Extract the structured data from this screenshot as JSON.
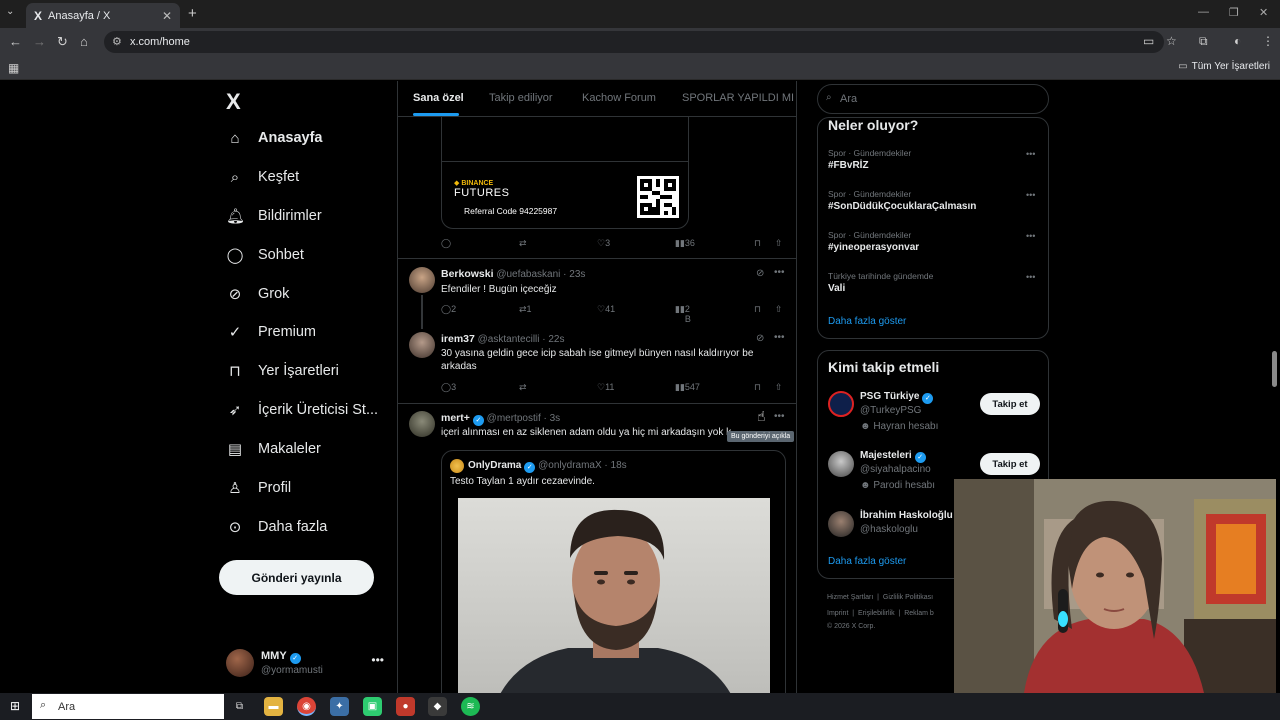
{
  "browser": {
    "tab_title": "Anasayfa / X",
    "tab_favicon": "X",
    "url": "x.com/home",
    "all_bookmarks": "Tüm Yer İşaretleri"
  },
  "sidebar": {
    "logo": "X",
    "items": [
      {
        "label": "Anasayfa",
        "icon": "home-icon"
      },
      {
        "label": "Keşfet",
        "icon": "search-icon"
      },
      {
        "label": "Bildirimler",
        "icon": "bell-icon"
      },
      {
        "label": "Sohbet",
        "icon": "chat-icon"
      },
      {
        "label": "Grok",
        "icon": "grok-icon"
      },
      {
        "label": "Premium",
        "icon": "premium-icon"
      },
      {
        "label": "Yer İşaretleri",
        "icon": "bookmark-icon"
      },
      {
        "label": "İçerik Üreticisi St...",
        "icon": "rocket-icon"
      },
      {
        "label": "Makaleler",
        "icon": "articles-icon"
      },
      {
        "label": "Profil",
        "icon": "person-icon"
      },
      {
        "label": "Daha fazla",
        "icon": "more-circle-icon"
      }
    ],
    "post_button": "Gönderi yayınla",
    "profile": {
      "name": "MMY",
      "handle": "@yormamusti"
    }
  },
  "feed": {
    "tabs": [
      "Sana özel",
      "Takip ediliyor",
      "Kachow Forum",
      "SPORLAR YAPILDI MI"
    ],
    "active_tab": 0,
    "top_card": {
      "brand": "BINANCE",
      "product": "FUTURES",
      "referral": "Referral Code 94225987"
    },
    "top_actions": {
      "replies": "",
      "reposts": "",
      "likes": "3",
      "views": "36"
    },
    "tweets": [
      {
        "name": "Berkowski",
        "handle": "@uefabaskani",
        "time": "23s",
        "text": "Efendiler ! Bugün içeceğiz",
        "replies": "2",
        "reposts": "1",
        "likes": "41",
        "views": "2 B"
      },
      {
        "name": "irem37",
        "handle": "@asktantecilli",
        "time": "22s",
        "text": "30 yasına geldin gece icip sabah ise gitmeyl bünyen nasıl kaldırıyor be arkadas",
        "replies": "3",
        "reposts": "",
        "likes": "11",
        "views": "547"
      },
      {
        "name": "mert+",
        "handle": "@mertpostif",
        "time": "3s",
        "text": "içeri alınması en az siklenen adam oldu ya hiç mi arkadaşın yok la bunun",
        "quote": {
          "name": "OnlyDrama",
          "handle": "@onlydramaX",
          "time": "18s",
          "text": "Testo Taylan 1 aydır cezaevinde."
        }
      }
    ],
    "tooltip": "Bu gönderiyi açıkla"
  },
  "right": {
    "search_placeholder": "Ara",
    "trends_title": "Neler oluyor?",
    "trends": [
      {
        "meta": "Spor · Gündemdekiler",
        "name": "#FBvRİZ"
      },
      {
        "meta": "Spor · Gündemdekiler",
        "name": "#SonDüdükÇocuklaraÇalmasın"
      },
      {
        "meta": "Spor · Gündemdekiler",
        "name": "#yineoperasyonvar"
      },
      {
        "meta": "Türkiye tarihinde gündemde",
        "name": "Vali"
      }
    ],
    "trends_more": "Daha fazla göster",
    "wtf_title": "Kimi takip etmeli",
    "wtf": [
      {
        "name": "PSG Türkiye",
        "handle": "@TurkeyPSG",
        "sub": "Hayran hesabı",
        "button": "Takip et"
      },
      {
        "name": "Majesteleri",
        "handle": "@siyahalpacino",
        "sub": "Parodi hesabı",
        "button": "Takip et"
      },
      {
        "name": "İbrahim Haskoloğlu",
        "handle": "@haskologlu"
      }
    ],
    "wtf_more": "Daha fazla göster",
    "footer": {
      "line1": [
        "Hizmet Şartları",
        "Gizlilik Politikası"
      ],
      "line2": [
        "Imprint",
        "Erişilebilirlik",
        "Reklam b"
      ],
      "copyright": "© 2026 X Corp."
    }
  },
  "taskbar": {
    "search_placeholder": "Ara"
  },
  "colors": {
    "accent": "#1d9bf0",
    "background": "#000000",
    "border": "#2f3336",
    "muted_text": "#71767b"
  }
}
